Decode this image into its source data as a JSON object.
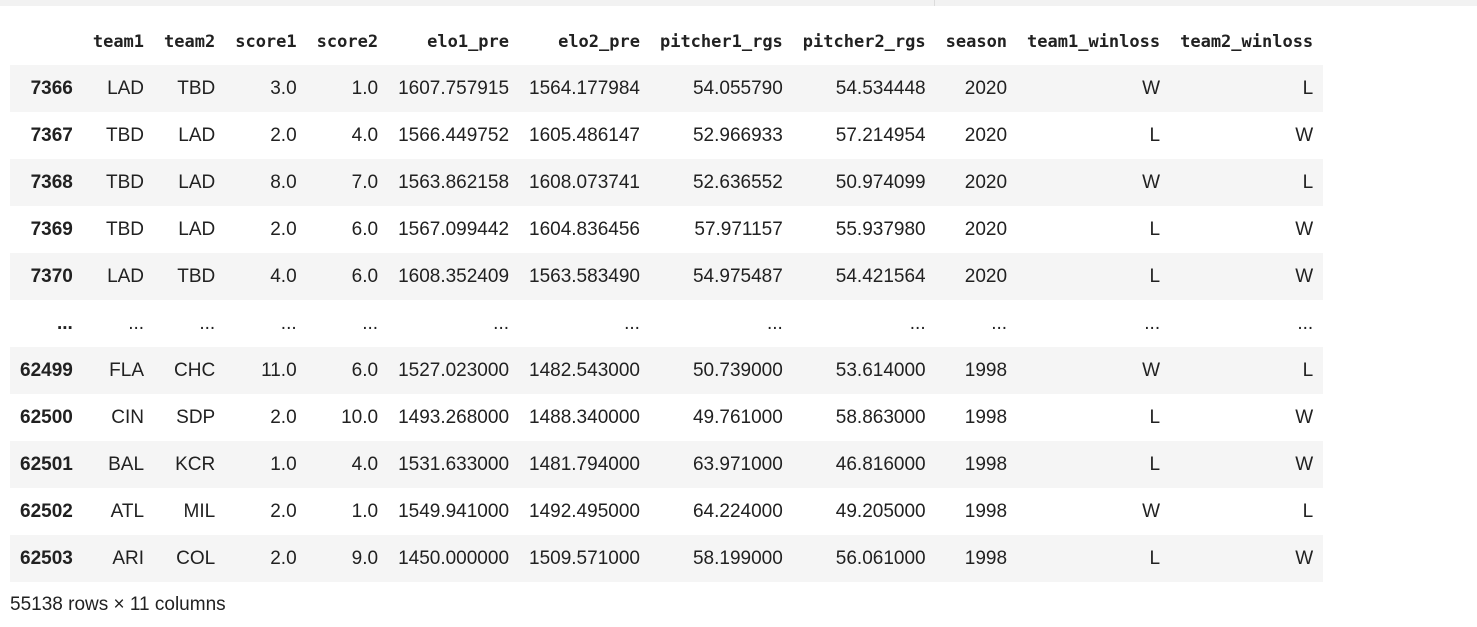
{
  "table": {
    "index_header": "",
    "columns": [
      "team1",
      "team2",
      "score1",
      "score2",
      "elo1_pre",
      "elo2_pre",
      "pitcher1_rgs",
      "pitcher2_rgs",
      "season",
      "team1_winloss",
      "team2_winloss"
    ],
    "rows": [
      {
        "index": "7366",
        "cells": [
          "LAD",
          "TBD",
          "3.0",
          "1.0",
          "1607.757915",
          "1564.177984",
          "54.055790",
          "54.534448",
          "2020",
          "W",
          "L"
        ]
      },
      {
        "index": "7367",
        "cells": [
          "TBD",
          "LAD",
          "2.0",
          "4.0",
          "1566.449752",
          "1605.486147",
          "52.966933",
          "57.214954",
          "2020",
          "L",
          "W"
        ]
      },
      {
        "index": "7368",
        "cells": [
          "TBD",
          "LAD",
          "8.0",
          "7.0",
          "1563.862158",
          "1608.073741",
          "52.636552",
          "50.974099",
          "2020",
          "W",
          "L"
        ]
      },
      {
        "index": "7369",
        "cells": [
          "TBD",
          "LAD",
          "2.0",
          "6.0",
          "1567.099442",
          "1604.836456",
          "57.971157",
          "55.937980",
          "2020",
          "L",
          "W"
        ]
      },
      {
        "index": "7370",
        "cells": [
          "LAD",
          "TBD",
          "4.0",
          "6.0",
          "1608.352409",
          "1563.583490",
          "54.975487",
          "54.421564",
          "2020",
          "L",
          "W"
        ]
      },
      {
        "index": "...",
        "cells": [
          "...",
          "...",
          "...",
          "...",
          "...",
          "...",
          "...",
          "...",
          "...",
          "...",
          "..."
        ]
      },
      {
        "index": "62499",
        "cells": [
          "FLA",
          "CHC",
          "11.0",
          "6.0",
          "1527.023000",
          "1482.543000",
          "50.739000",
          "53.614000",
          "1998",
          "W",
          "L"
        ]
      },
      {
        "index": "62500",
        "cells": [
          "CIN",
          "SDP",
          "2.0",
          "10.0",
          "1493.268000",
          "1488.340000",
          "49.761000",
          "58.863000",
          "1998",
          "L",
          "W"
        ]
      },
      {
        "index": "62501",
        "cells": [
          "BAL",
          "KCR",
          "1.0",
          "4.0",
          "1531.633000",
          "1481.794000",
          "63.971000",
          "46.816000",
          "1998",
          "L",
          "W"
        ]
      },
      {
        "index": "62502",
        "cells": [
          "ATL",
          "MIL",
          "2.0",
          "1.0",
          "1549.941000",
          "1492.495000",
          "64.224000",
          "49.205000",
          "1998",
          "W",
          "L"
        ]
      },
      {
        "index": "62503",
        "cells": [
          "ARI",
          "COL",
          "2.0",
          "9.0",
          "1450.000000",
          "1509.571000",
          "58.199000",
          "56.061000",
          "1998",
          "L",
          "W"
        ]
      }
    ]
  },
  "footer": {
    "shape_text": "55138 rows × 11 columns"
  }
}
